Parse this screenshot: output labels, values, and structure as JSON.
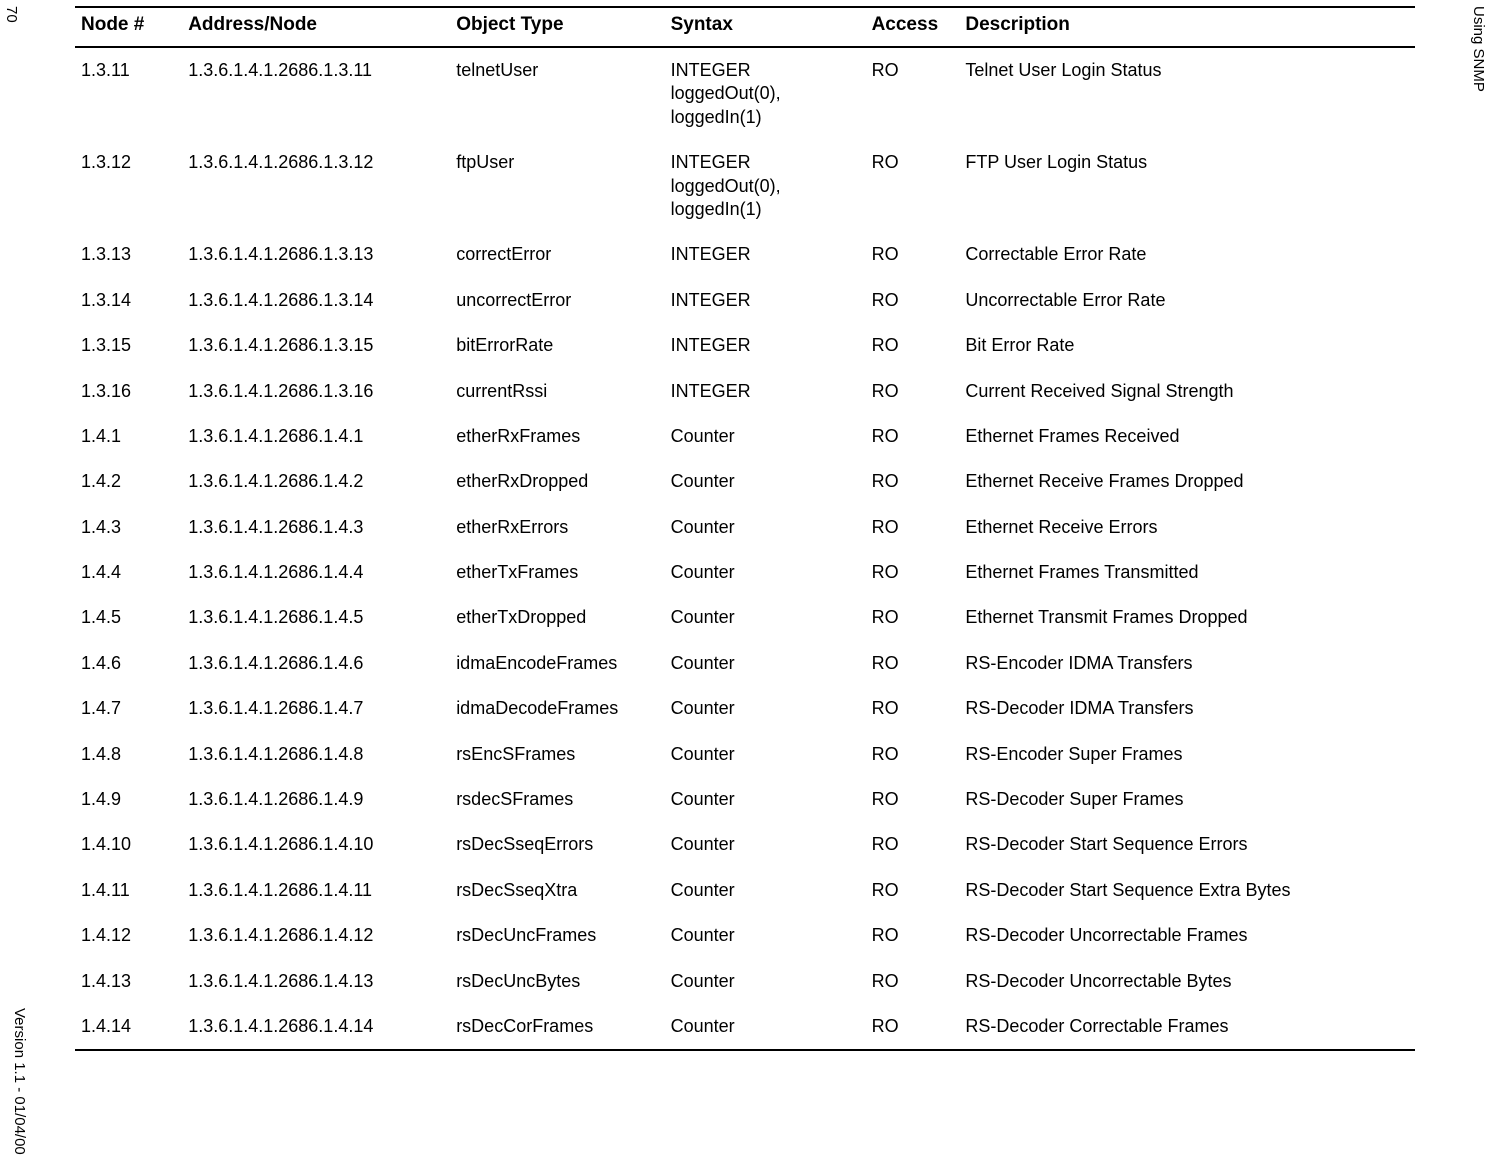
{
  "meta": {
    "page_number": "70",
    "section_title": "Using SNMP",
    "version_footer": "Version 1.1 - 01/04/00"
  },
  "table": {
    "headers": {
      "node": "Node #",
      "address": "Address/Node",
      "object": "Object Type",
      "syntax": "Syntax",
      "access": "Access",
      "description": "Description"
    },
    "rows": [
      {
        "node": "1.3.11",
        "address": "1.3.6.1.4.1.2686.1.3.11",
        "object": "telnetUser",
        "syntax": "INTEGER loggedOut(0), loggedIn(1)",
        "access": "RO",
        "description": "Telnet User Login Status"
      },
      {
        "node": "1.3.12",
        "address": "1.3.6.1.4.1.2686.1.3.12",
        "object": "ftpUser",
        "syntax": "INTEGER loggedOut(0), loggedIn(1)",
        "access": "RO",
        "description": "FTP User Login Status"
      },
      {
        "node": "1.3.13",
        "address": "1.3.6.1.4.1.2686.1.3.13",
        "object": "correctError",
        "syntax": "INTEGER",
        "access": "RO",
        "description": "Correctable Error Rate"
      },
      {
        "node": "1.3.14",
        "address": "1.3.6.1.4.1.2686.1.3.14",
        "object": "uncorrectError",
        "syntax": "INTEGER",
        "access": "RO",
        "description": "Uncorrectable Error Rate"
      },
      {
        "node": "1.3.15",
        "address": "1.3.6.1.4.1.2686.1.3.15",
        "object": "bitErrorRate",
        "syntax": "INTEGER",
        "access": "RO",
        "description": "Bit Error Rate"
      },
      {
        "node": "1.3.16",
        "address": "1.3.6.1.4.1.2686.1.3.16",
        "object": "currentRssi",
        "syntax": "INTEGER",
        "access": "RO",
        "description": "Current Received Signal Strength"
      },
      {
        "node": "1.4.1",
        "address": "1.3.6.1.4.1.2686.1.4.1",
        "object": "etherRxFrames",
        "syntax": "Counter",
        "access": "RO",
        "description": "Ethernet Frames Received"
      },
      {
        "node": "1.4.2",
        "address": "1.3.6.1.4.1.2686.1.4.2",
        "object": "etherRxDropped",
        "syntax": "Counter",
        "access": "RO",
        "description": "Ethernet Receive Frames Dropped"
      },
      {
        "node": "1.4.3",
        "address": "1.3.6.1.4.1.2686.1.4.3",
        "object": "etherRxErrors",
        "syntax": "Counter",
        "access": "RO",
        "description": "Ethernet Receive Errors"
      },
      {
        "node": "1.4.4",
        "address": "1.3.6.1.4.1.2686.1.4.4",
        "object": "etherTxFrames",
        "syntax": "Counter",
        "access": "RO",
        "description": "Ethernet Frames Transmitted"
      },
      {
        "node": "1.4.5",
        "address": "1.3.6.1.4.1.2686.1.4.5",
        "object": "etherTxDropped",
        "syntax": "Counter",
        "access": "RO",
        "description": "Ethernet Transmit Frames Dropped"
      },
      {
        "node": "1.4.6",
        "address": "1.3.6.1.4.1.2686.1.4.6",
        "object": "idmaEncodeFrames",
        "syntax": "Counter",
        "access": "RO",
        "description": "RS-Encoder IDMA Transfers"
      },
      {
        "node": "1.4.7",
        "address": "1.3.6.1.4.1.2686.1.4.7",
        "object": "idmaDecodeFrames",
        "syntax": "Counter",
        "access": "RO",
        "description": "RS-Decoder IDMA Transfers"
      },
      {
        "node": "1.4.8",
        "address": "1.3.6.1.4.1.2686.1.4.8",
        "object": "rsEncSFrames",
        "syntax": "Counter",
        "access": "RO",
        "description": "RS-Encoder Super Frames"
      },
      {
        "node": "1.4.9",
        "address": "1.3.6.1.4.1.2686.1.4.9",
        "object": "rsdecSFrames",
        "syntax": "Counter",
        "access": "RO",
        "description": "RS-Decoder Super Frames"
      },
      {
        "node": "1.4.10",
        "address": "1.3.6.1.4.1.2686.1.4.10",
        "object": "rsDecSseqErrors",
        "syntax": "Counter",
        "access": "RO",
        "description": "RS-Decoder Start Sequence Errors"
      },
      {
        "node": "1.4.11",
        "address": "1.3.6.1.4.1.2686.1.4.11",
        "object": "rsDecSseqXtra",
        "syntax": "Counter",
        "access": "RO",
        "description": "RS-Decoder Start Sequence Extra Bytes"
      },
      {
        "node": "1.4.12",
        "address": "1.3.6.1.4.1.2686.1.4.12",
        "object": "rsDecUncFrames",
        "syntax": "Counter",
        "access": "RO",
        "description": "RS-Decoder Uncorrectable Frames"
      },
      {
        "node": "1.4.13",
        "address": "1.3.6.1.4.1.2686.1.4.13",
        "object": "rsDecUncBytes",
        "syntax": "Counter",
        "access": "RO",
        "description": "RS-Decoder Uncorrectable Bytes"
      },
      {
        "node": "1.4.14",
        "address": "1.3.6.1.4.1.2686.1.4.14",
        "object": "rsDecCorFrames",
        "syntax": "Counter",
        "access": "RO",
        "description": "RS-Decoder Correctable Frames"
      }
    ]
  }
}
